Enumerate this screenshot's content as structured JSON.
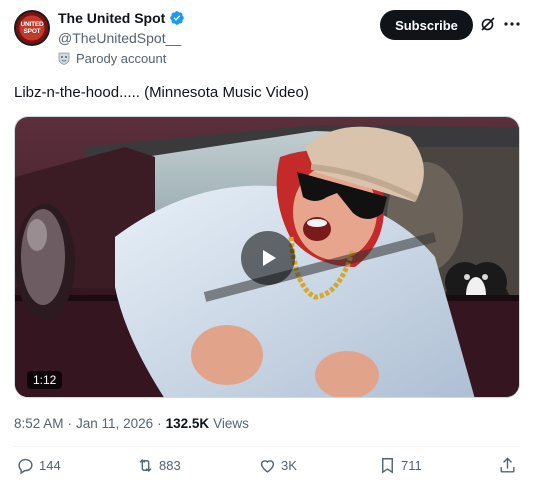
{
  "account": {
    "display_name": "The United Spot",
    "handle": "@TheUnitedSpot__",
    "parody_label": "Parody account",
    "avatar_text_line1": "UNITED",
    "avatar_text_line2": "SPOT"
  },
  "header": {
    "subscribe_label": "Subscribe"
  },
  "tweet": {
    "text": "Libz-n-the-hood..... (Minnesota Music Video)",
    "video_duration": "1:12",
    "time": "8:52 AM",
    "separator1": "·",
    "date": "Jan 11, 2026",
    "separator2": "·",
    "views_count": "132.5K",
    "views_label": "Views"
  },
  "actions": {
    "replies": "144",
    "reposts": "883",
    "likes": "3K",
    "bookmarks": "711"
  },
  "icons": {
    "verified": "verified-badge-icon",
    "grok": "grok-icon",
    "more": "more-dots-icon",
    "play": "play-icon",
    "reply": "reply-icon",
    "repost": "repost-icon",
    "like": "heart-icon",
    "bookmark": "bookmark-icon",
    "share": "share-icon"
  },
  "colors": {
    "accent_blue": "#1d9bf0",
    "text_primary": "#0f1419",
    "text_secondary": "#536471",
    "button_dark": "#0f1419"
  }
}
